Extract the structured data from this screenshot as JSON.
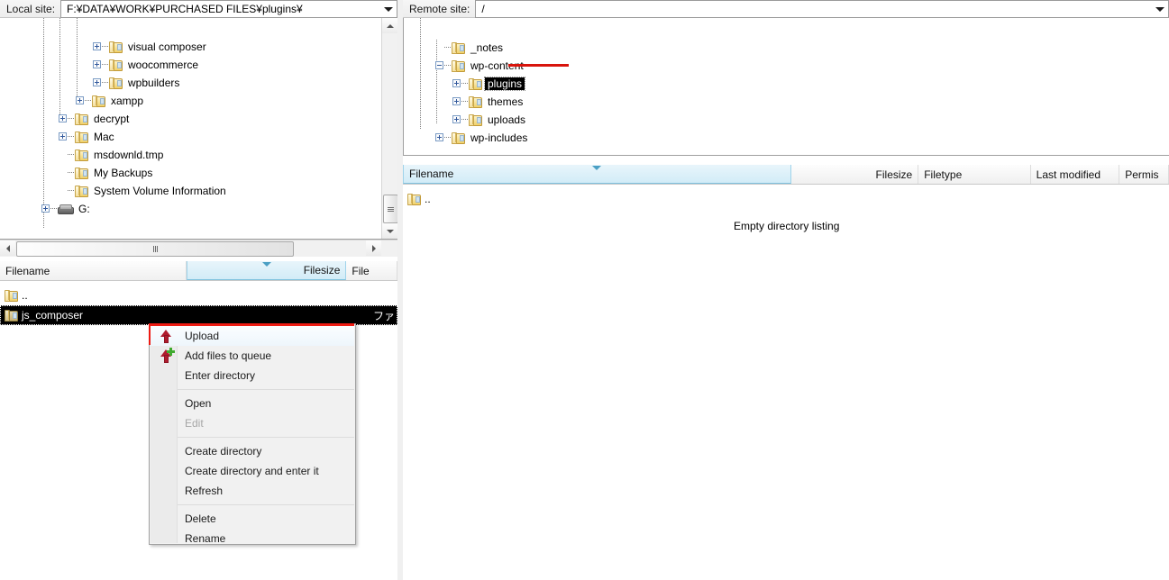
{
  "local": {
    "path_label": "Local site:",
    "path_value": "F:¥DATA¥WORK¥PURCHASED FILES¥plugins¥",
    "dropdown_icon": "chevron-down-icon",
    "tree": [
      {
        "label": "visual composer",
        "depth": 3,
        "expander": "plus",
        "icon": "folder-icon",
        "selected": false
      },
      {
        "label": "woocommerce",
        "depth": 3,
        "expander": "plus",
        "icon": "folder-icon",
        "selected": false
      },
      {
        "label": "wpbuilders",
        "depth": 3,
        "expander": "plus",
        "icon": "folder-icon",
        "selected": false
      },
      {
        "label": "xampp",
        "depth": 2,
        "expander": "plus",
        "icon": "folder-icon",
        "selected": false
      },
      {
        "label": "decrypt",
        "depth": 1,
        "expander": "plus",
        "icon": "folder-icon",
        "selected": false
      },
      {
        "label": "Mac",
        "depth": 1,
        "expander": "plus",
        "icon": "folder-icon",
        "selected": false
      },
      {
        "label": "msdownld.tmp",
        "depth": 1,
        "expander": "none",
        "icon": "folder-icon",
        "selected": false
      },
      {
        "label": "My Backups",
        "depth": 1,
        "expander": "none",
        "icon": "folder-icon",
        "selected": false
      },
      {
        "label": "System Volume Information",
        "depth": 1,
        "expander": "none",
        "icon": "folder-icon",
        "selected": false
      },
      {
        "label": "G:",
        "depth": 0,
        "expander": "plus",
        "icon": "drive-icon",
        "selected": false
      }
    ],
    "columns": [
      {
        "label": "Filename",
        "sorted": false,
        "align": "left"
      },
      {
        "label": "Filesize",
        "sorted": true,
        "align": "right"
      },
      {
        "label": "File",
        "sorted": false,
        "align": "left"
      }
    ],
    "rows": [
      {
        "name": "..",
        "filetype": "",
        "icon": "folder-icon",
        "selected": false
      },
      {
        "name": "js_composer",
        "filetype": "ファ",
        "icon": "folder-icon",
        "selected": true
      }
    ]
  },
  "remote": {
    "path_label": "Remote site:",
    "path_value": "/",
    "dropdown_icon": "chevron-down-icon",
    "tree": [
      {
        "label": "_notes",
        "depth": 1,
        "expander": "none",
        "icon": "folder-icon",
        "selected": false
      },
      {
        "label": "wp-content",
        "depth": 1,
        "expander": "minus",
        "icon": "folder-icon",
        "selected": false
      },
      {
        "label": "plugins",
        "depth": 2,
        "expander": "plus",
        "icon": "folder-icon",
        "selected": true
      },
      {
        "label": "themes",
        "depth": 2,
        "expander": "plus",
        "icon": "folder-icon",
        "selected": false
      },
      {
        "label": "uploads",
        "depth": 2,
        "expander": "plus",
        "icon": "folder-icon",
        "selected": false
      },
      {
        "label": "wp-includes",
        "depth": 1,
        "expander": "plus",
        "icon": "folder-icon",
        "selected": false
      }
    ],
    "columns": [
      {
        "label": "Filename",
        "sorted": true,
        "align": "left"
      },
      {
        "label": "Filesize",
        "sorted": false,
        "align": "right"
      },
      {
        "label": "Filetype",
        "sorted": false,
        "align": "left"
      },
      {
        "label": "Last modified",
        "sorted": false,
        "align": "left"
      },
      {
        "label": "Permis",
        "sorted": false,
        "align": "left"
      }
    ],
    "rows": [
      {
        "name": "..",
        "icon": "folder-icon",
        "selected": false
      }
    ],
    "empty_message": "Empty directory listing"
  },
  "context_menu": {
    "items": [
      {
        "label": "Upload",
        "icon": "upload-arrow-icon",
        "state": "hover"
      },
      {
        "label": "Add files to queue",
        "icon": "add-to-queue-icon",
        "state": "normal"
      },
      {
        "label": "Enter directory",
        "icon": "",
        "state": "normal"
      },
      {
        "label": "",
        "icon": "",
        "state": "separator"
      },
      {
        "label": "Open",
        "icon": "",
        "state": "normal"
      },
      {
        "label": "Edit",
        "icon": "",
        "state": "disabled"
      },
      {
        "label": "",
        "icon": "",
        "state": "separator"
      },
      {
        "label": "Create directory",
        "icon": "",
        "state": "normal"
      },
      {
        "label": "Create directory and enter it",
        "icon": "",
        "state": "normal"
      },
      {
        "label": "Refresh",
        "icon": "",
        "state": "normal"
      },
      {
        "label": "",
        "icon": "",
        "state": "separator"
      },
      {
        "label": "Delete",
        "icon": "",
        "state": "normal"
      },
      {
        "label": "Rename",
        "icon": "",
        "state": "normal"
      }
    ]
  },
  "annotations": {
    "highlight_color": "#ee1b13",
    "line_color": "#d8140c"
  }
}
